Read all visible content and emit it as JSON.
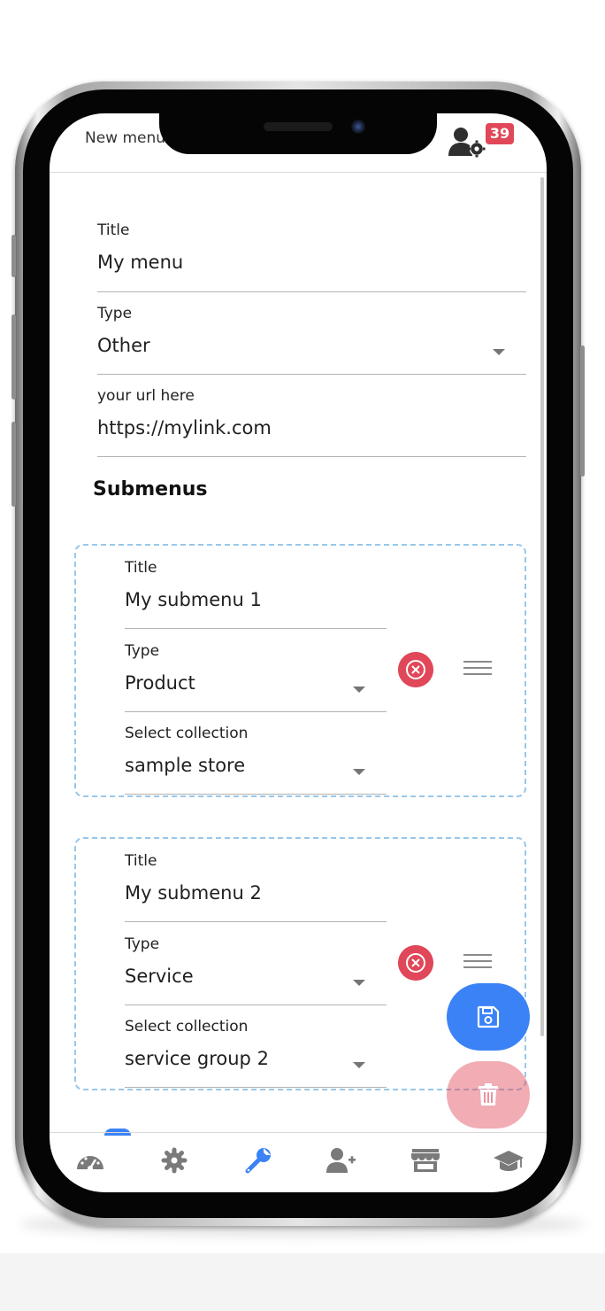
{
  "header": {
    "title": "New menu",
    "notification_count": "39"
  },
  "form": {
    "title_label": "Title",
    "title_value": "My menu",
    "type_label": "Type",
    "type_value": "Other",
    "url_label": "your url here",
    "url_value": "https://mylink.com"
  },
  "submenus_heading": "Submenus",
  "submenus": [
    {
      "title_label": "Title",
      "title_value": "My submenu 1",
      "type_label": "Type",
      "type_value": "Product",
      "collection_label": "Select collection",
      "collection_value": "sample store"
    },
    {
      "title_label": "Title",
      "title_value": "My submenu 2",
      "type_label": "Type",
      "type_value": "Service",
      "collection_label": "Select collection",
      "collection_value": "service group 2"
    }
  ],
  "nav": {
    "items": [
      "dashboard-icon",
      "settings-icon",
      "wrench-icon",
      "add-user-icon",
      "store-icon",
      "graduation-cap-icon"
    ],
    "active": "wrench-icon"
  },
  "colors": {
    "accent": "#3b82f6",
    "danger": "#e04758",
    "dashed_border": "#98c7ea",
    "icon_inactive": "#7a7a7a"
  }
}
